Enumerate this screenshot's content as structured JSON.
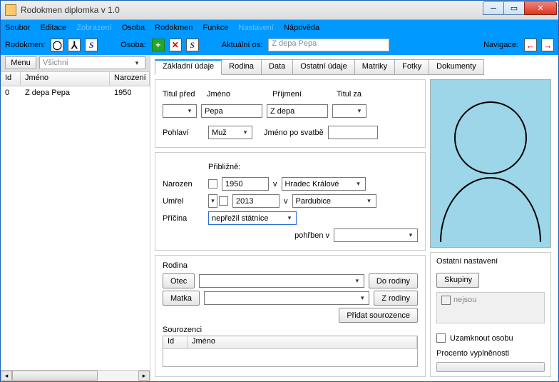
{
  "title": "Rodokmen diplomka v 1.0",
  "menubar": [
    "Soubor",
    "Editace",
    "Zobrazení",
    "Osoba",
    "Rodokmen",
    "Funkce",
    "Nastavení",
    "Nápověda"
  ],
  "menubar_disabled_idx": [
    2,
    6
  ],
  "toolbar": {
    "rodokmen_lbl": "Rodokmen:",
    "osoba_lbl": "Osoba:",
    "aktualni_lbl": "Aktuální os:",
    "aktualni_val": "Z depa Pepa",
    "navigace_lbl": "Navigace:"
  },
  "left": {
    "menu_btn": "Menu",
    "filter_val": "Všichni",
    "cols": {
      "id": "Id",
      "jmeno": "Jméno",
      "narozeni": "Narození"
    },
    "rows": [
      {
        "id": "0",
        "jmeno": "Z depa Pepa",
        "nar": "1950"
      }
    ]
  },
  "tabs": [
    "Základní údaje",
    "Rodina",
    "Data",
    "Ostatní údaje",
    "Matriky",
    "Fotky",
    "Dokumenty"
  ],
  "basic": {
    "titul_pred": "Titul před",
    "jmeno": "Jméno",
    "prijmeni": "Příjmení",
    "titul_za": "Titul za",
    "jmeno_val": "Pepa",
    "prijmeni_val": "Z depa",
    "pohlavi": "Pohlaví",
    "pohlavi_val": "Muž",
    "jmeno_po_svatbe": "Jméno po svatbě",
    "priblizne": "Přibližně:",
    "narozen": "Narozen",
    "narozen_val": "1950",
    "v": "v",
    "narozen_misto": "Hradec Králové",
    "umrel": "Umřel",
    "umrel_val": "2013",
    "umrel_misto": "Pardubice",
    "pricina": "Příčina",
    "pricina_val": "nepřežil státnice",
    "pohrben": "pohřben v"
  },
  "rodina": {
    "title": "Rodina",
    "otec": "Otec",
    "matka": "Matka",
    "do_rodiny": "Do rodiny",
    "z_rodiny": "Z rodiny",
    "pridat_sourozence": "Přidat sourozence",
    "sourozenci": "Sourozenci",
    "col_id": "Id",
    "col_jmeno": "Jméno"
  },
  "ostatni": {
    "title": "Ostatní nastavení",
    "skupiny": "Skupiny",
    "nejsou": "nejsou",
    "uzamknout": "Uzamknout osobu",
    "procento": "Procento vyplněnosti"
  }
}
